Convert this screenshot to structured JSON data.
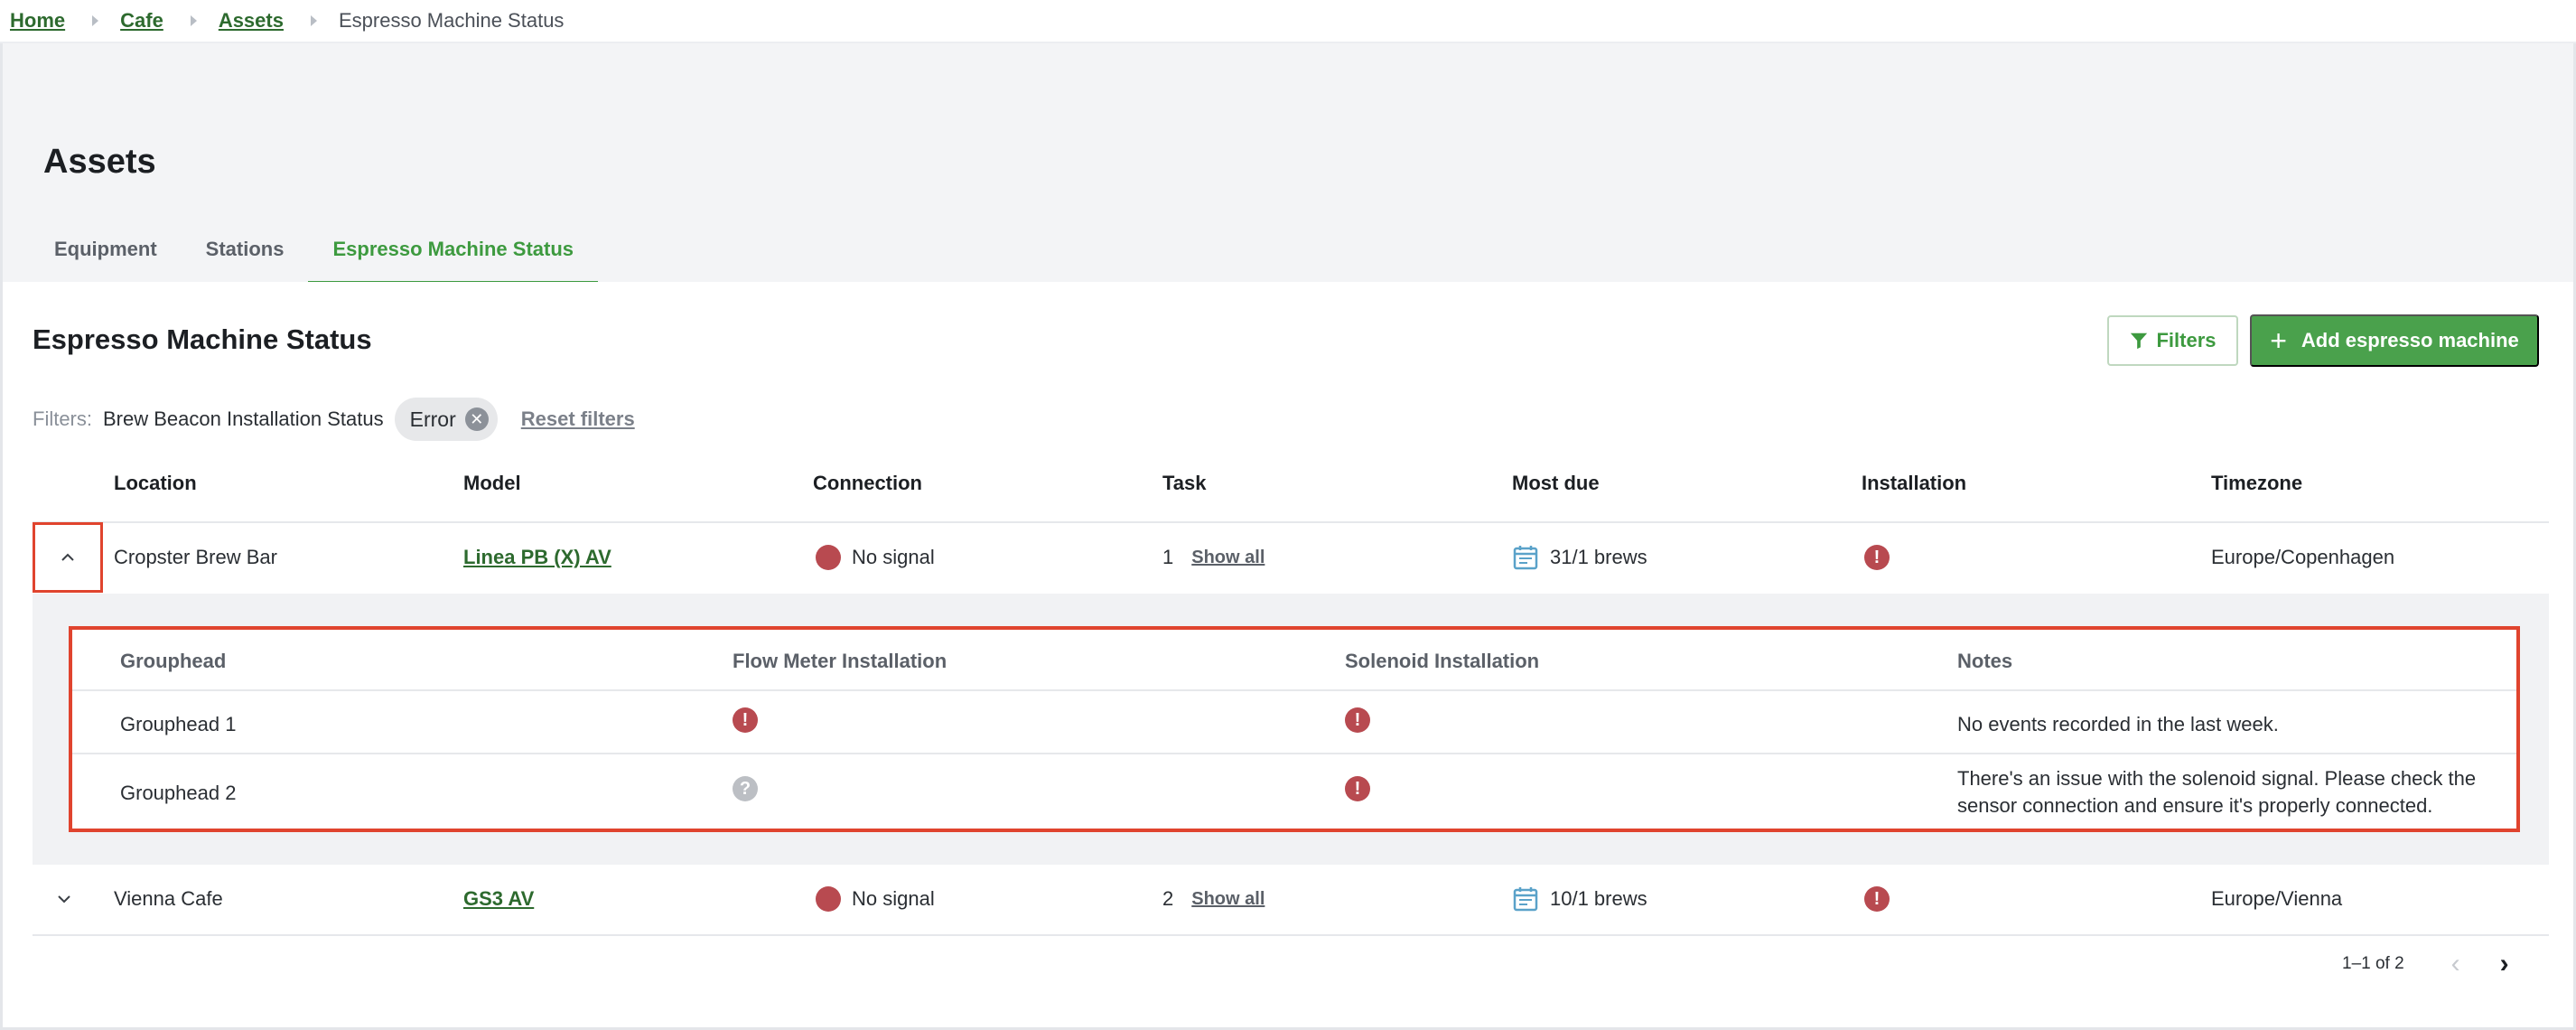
{
  "breadcrumb": {
    "items": [
      "Home",
      "Cafe",
      "Assets"
    ],
    "current": "Espresso Machine Status"
  },
  "page": {
    "title": "Assets",
    "tabs": [
      "Equipment",
      "Stations",
      "Espresso Machine Status"
    ],
    "active_tab": "Espresso Machine Status"
  },
  "card": {
    "title": "Espresso Machine Status",
    "filters_button": "Filters",
    "add_button": "Add espresso machine"
  },
  "filters": {
    "label": "Filters:",
    "key": "Brew Beacon Installation Status",
    "chip": "Error",
    "reset": "Reset filters"
  },
  "table": {
    "columns": [
      "Location",
      "Model",
      "Connection",
      "Task",
      "Most due",
      "Installation",
      "Timezone"
    ],
    "rows": [
      {
        "location": "Cropster Brew Bar",
        "model": "Linea PB (X) AV",
        "connection": "No signal",
        "task_count": "1",
        "task_link": "Show all",
        "most_due": "31/1 brews",
        "installation_icon": "error-icon",
        "timezone": "Europe/Copenhagen",
        "expanded": true
      },
      {
        "location": "Vienna Cafe",
        "model": "GS3 AV",
        "connection": "No signal",
        "task_count": "2",
        "task_link": "Show all",
        "most_due": "10/1 brews",
        "installation_icon": "error-icon",
        "timezone": "Europe/Vienna",
        "expanded": false
      }
    ]
  },
  "subtable": {
    "columns": [
      "Grouphead",
      "Flow Meter Installation",
      "Solenoid Installation",
      "Notes"
    ],
    "rows": [
      {
        "grouphead": "Grouphead 1",
        "flow_meter_icon": "error-icon",
        "solenoid_icon": "error-icon",
        "notes": "No events recorded in the last week."
      },
      {
        "grouphead": "Grouphead 2",
        "flow_meter_icon": "unknown-icon",
        "solenoid_icon": "error-icon",
        "notes": "There's an issue with the solenoid signal. Please check the sensor connection and ensure it's properly connected."
      }
    ]
  },
  "pagination": {
    "range": "1–1 of 2"
  },
  "colors": {
    "accent": "#4aa14c",
    "link": "#2d6a2e",
    "error": "#b84a50",
    "highlight": "#e0442e"
  }
}
